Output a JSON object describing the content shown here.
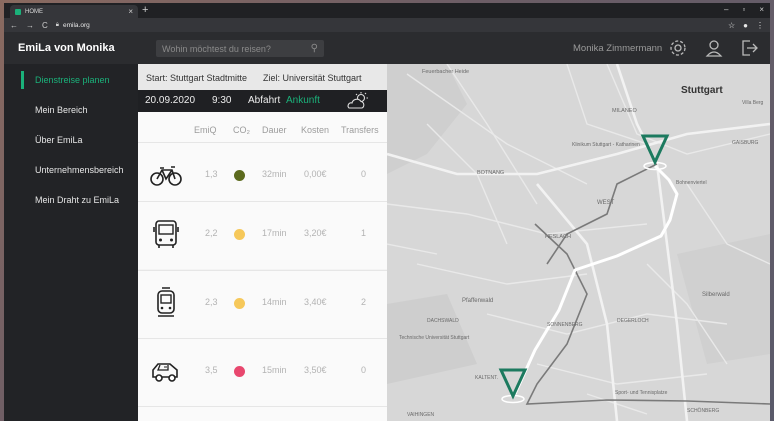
{
  "browser": {
    "tab_title": "HOME",
    "tab_close": "×",
    "new_tab": "+",
    "url": "emila.org",
    "back": "←",
    "forward": "→",
    "reload": "C",
    "star": "☆",
    "account": "●",
    "menu": "⋮",
    "minimize": "–",
    "maximize": "▫",
    "close": "×"
  },
  "header": {
    "brand": "EmiLa von Monika",
    "search_placeholder": "Wohin möchtest du reisen?",
    "user_name": "Monika Zimmermann",
    "icons": [
      "gear-icon",
      "user-icon",
      "logout-icon"
    ]
  },
  "sidebar": {
    "items": [
      {
        "label": "Dienstreise planen",
        "active": true
      },
      {
        "label": "Mein Bereich",
        "active": false
      },
      {
        "label": "Über EmiLa",
        "active": false
      },
      {
        "label": "Unternehmensbereich",
        "active": false
      },
      {
        "label": "Mein Draht zu EmiLa",
        "active": false
      }
    ],
    "accent": "#1bb17a"
  },
  "route": {
    "start": "Start: Stuttgart Stadtmitte",
    "end": "Ziel: Universität Stuttgart",
    "date": "20.09.2020",
    "time": "9:30",
    "departure": "Abfahrt",
    "arrival": "Ankunft",
    "weather_icon": "partly-cloudy-icon"
  },
  "table": {
    "headers": [
      "EmiQ",
      "CO₂",
      "Dauer",
      "Kosten",
      "Transfers"
    ],
    "rows": [
      {
        "mode": "bicycle-icon",
        "emiq": "1,3",
        "co2_color": "#5c6a1e",
        "dauer": "32min",
        "kosten": "0,00€",
        "transfers": "0"
      },
      {
        "mode": "bus-icon",
        "emiq": "2,2",
        "co2_color": "#f6c85a",
        "dauer": "17min",
        "kosten": "3,20€",
        "transfers": "1"
      },
      {
        "mode": "tram-icon",
        "emiq": "2,3",
        "co2_color": "#f6c85a",
        "dauer": "14min",
        "kosten": "3,40€",
        "transfers": "2"
      },
      {
        "mode": "car-icon",
        "emiq": "3,5",
        "co2_color": "#e8476e",
        "dauer": "15min",
        "kosten": "3,50€",
        "transfers": "0"
      }
    ]
  },
  "map": {
    "labels": {
      "stuttgart": "Stuttgart",
      "nord": "Stuttgart-Nord",
      "west": "WEST",
      "heslach": "HESLACH",
      "botnang": "BOTNANG",
      "dachswald": "DACHSWALD",
      "pfaffenwald": "Pfaffenwald",
      "sonnenberg": "SONNENBERG",
      "degerloch": "DEGERLOCH",
      "silberwald": "Silberwald",
      "kaltental": "KALTENT.",
      "vaihingen": "VAIHINGEN",
      "uni": "Technische Universität Stuttgart",
      "schoenberg": "SCHÖNBERG",
      "gaisburg": "GAISBURG",
      "villa_berg": "Villa Berg",
      "feuerbach": "Feuerbacher Heide",
      "milaneo": "MILANEO",
      "klinikum": "Klinikum Stuttgart - Katharinen",
      "bohnen": "Bohnenviertel",
      "sport": "Sport- und Tennisplatze",
      "kalten": "Waldfriedhof"
    },
    "route_color": "#ffffff",
    "marker_color": "#1c7a5f"
  }
}
